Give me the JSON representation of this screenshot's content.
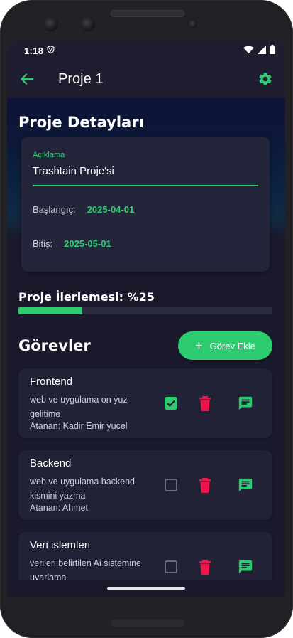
{
  "status_bar": {
    "time": "1:18"
  },
  "app_bar": {
    "title": "Proje 1"
  },
  "details": {
    "section_title": "Proje Detayları",
    "description_label": "Açıklama",
    "description_value": "Trashtain Proje'si",
    "start_label": "Başlangıç:",
    "start_value": "2025-04-01",
    "end_label": "Bitiş:",
    "end_value": "2025-05-01"
  },
  "progress": {
    "label": "Proje İlerlemesi: %25",
    "value_percent": 25
  },
  "tasks": {
    "section_title": "Görevler",
    "add_button_label": "Görev Ekle",
    "items": [
      {
        "title": "Frontend",
        "description": "web ve uygulama on yuz gelitime",
        "assignee": "Atanan: Kadir Emir yucel",
        "done": true
      },
      {
        "title": "Backend",
        "description": "web ve uygulama backend kismini yazma",
        "assignee": "Atanan: Ahmet",
        "done": false
      },
      {
        "title": "Veri islemleri",
        "description": "verileri belirtilen Ai sistemine uyarlama",
        "assignee": "",
        "done": false
      }
    ]
  },
  "colors": {
    "accent": "#2ecc71",
    "danger": "#f0144b",
    "background": "#1a1a2c",
    "card": "#222236"
  }
}
